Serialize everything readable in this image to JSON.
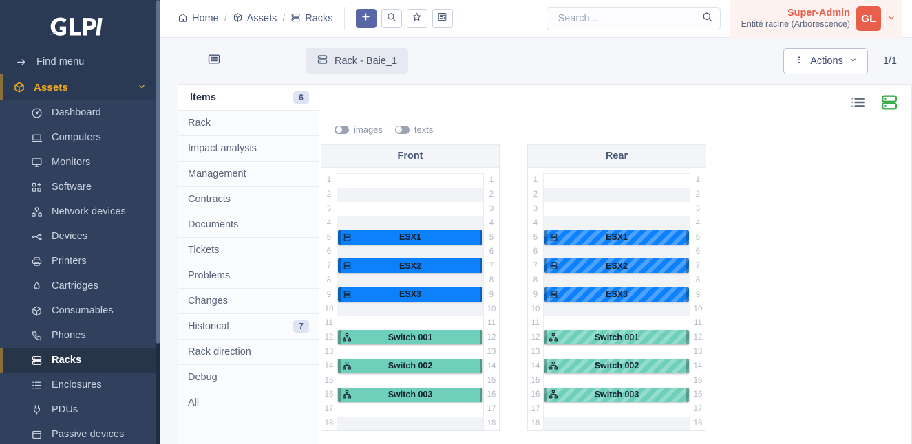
{
  "brand": {
    "name": "GLPI"
  },
  "colors": {
    "sidebar_bg": "#2b3a54",
    "sidebar_sub_bg": "#31415d",
    "accent_orange": "#f0a81e",
    "user_red": "#e8604c",
    "server_blue": "#0d81fb",
    "switch_teal": "#6ed0bb",
    "active_green": "#3cab4b",
    "primary_button": "#5866a5"
  },
  "sidebar": {
    "find_menu": {
      "label": "Find menu",
      "icon": "arrow-right-icon"
    },
    "section": {
      "label": "Assets",
      "icon": "box-icon",
      "caret": "chevron-down-icon"
    },
    "items": [
      {
        "label": "Dashboard",
        "icon": "dashboard-icon",
        "active": false
      },
      {
        "label": "Computers",
        "icon": "computer-icon",
        "active": false
      },
      {
        "label": "Monitors",
        "icon": "monitor-icon",
        "active": false
      },
      {
        "label": "Software",
        "icon": "software-icon",
        "active": false
      },
      {
        "label": "Network devices",
        "icon": "network-device-icon",
        "active": false
      },
      {
        "label": "Devices",
        "icon": "usb-icon",
        "active": false
      },
      {
        "label": "Printers",
        "icon": "printer-icon",
        "active": false
      },
      {
        "label": "Cartridges",
        "icon": "cartridge-icon",
        "active": false
      },
      {
        "label": "Consumables",
        "icon": "consumable-icon",
        "active": false
      },
      {
        "label": "Phones",
        "icon": "phone-icon",
        "active": false
      },
      {
        "label": "Racks",
        "icon": "rack-icon",
        "active": true
      },
      {
        "label": "Enclosures",
        "icon": "enclosure-icon",
        "active": false
      },
      {
        "label": "PDUs",
        "icon": "pdu-icon",
        "active": false
      },
      {
        "label": "Passive devices",
        "icon": "passive-device-icon",
        "active": false
      }
    ]
  },
  "header": {
    "breadcrumb": [
      {
        "label": "Home",
        "icon": "home-icon"
      },
      {
        "label": "Assets",
        "icon": "box-icon"
      },
      {
        "label": "Racks",
        "icon": "rack-icon"
      }
    ],
    "separator": "/",
    "buttons": [
      {
        "name": "add-button",
        "icon": "plus-icon",
        "label": "+",
        "primary": true
      },
      {
        "name": "search-button",
        "icon": "search-icon",
        "label": "",
        "primary": false
      },
      {
        "name": "favorite-button",
        "icon": "star-icon",
        "label": "",
        "primary": false
      },
      {
        "name": "saved-searches-button",
        "icon": "list-settings-icon",
        "label": "",
        "primary": false
      }
    ],
    "search": {
      "placeholder": "Search...",
      "value": "",
      "icon": "search-icon"
    },
    "user": {
      "name": "Super-Admin",
      "entity": "Entité racine (Arborescence)",
      "initials": "GL",
      "caret": "chevron-down-icon"
    }
  },
  "toolbar": {
    "list_toggle_icon": "list-panel-icon",
    "tab": {
      "label": "Rack - Baie_1",
      "icon": "rack-icon"
    },
    "actions": {
      "label": "Actions",
      "icon": "dots-vertical-icon",
      "caret": "chevron-down-icon"
    },
    "pager": "1/1"
  },
  "menu": {
    "header": {
      "label": "Items",
      "badge": "6"
    },
    "items": [
      {
        "label": "Rack",
        "badge": ""
      },
      {
        "label": "Impact analysis",
        "badge": ""
      },
      {
        "label": "Management",
        "badge": ""
      },
      {
        "label": "Contracts",
        "badge": ""
      },
      {
        "label": "Documents",
        "badge": ""
      },
      {
        "label": "Tickets",
        "badge": ""
      },
      {
        "label": "Problems",
        "badge": ""
      },
      {
        "label": "Changes",
        "badge": ""
      },
      {
        "label": "Historical",
        "badge": "7"
      },
      {
        "label": "Rack direction",
        "badge": ""
      },
      {
        "label": "Debug",
        "badge": ""
      },
      {
        "label": "All",
        "badge": ""
      }
    ]
  },
  "rackview": {
    "view_buttons": [
      {
        "name": "list-view-button",
        "icon": "list-icon",
        "active": false
      },
      {
        "name": "rack-view-button",
        "icon": "rack-icon",
        "active": true
      }
    ],
    "toggles": [
      {
        "label": "images",
        "on": false
      },
      {
        "label": "texts",
        "on": false
      }
    ],
    "units": [
      1,
      2,
      3,
      4,
      5,
      6,
      7,
      8,
      9,
      10,
      11,
      12,
      13,
      14,
      15,
      16,
      17,
      18
    ],
    "panels": [
      {
        "title": "Front",
        "hatched": false,
        "devices": [
          {
            "name": "ESX1",
            "unit": 5,
            "height": 1,
            "color": "#0d81fb",
            "icon": "server-icon"
          },
          {
            "name": "ESX2",
            "unit": 7,
            "height": 1,
            "color": "#0d81fb",
            "icon": "server-icon"
          },
          {
            "name": "ESX3",
            "unit": 9,
            "height": 1,
            "color": "#0d81fb",
            "icon": "server-icon"
          },
          {
            "name": "Switch 001",
            "unit": 12,
            "height": 1,
            "color": "#6ed0bb",
            "icon": "network-device-icon"
          },
          {
            "name": "Switch 002",
            "unit": 14,
            "height": 1,
            "color": "#6ed0bb",
            "icon": "network-device-icon"
          },
          {
            "name": "Switch 003",
            "unit": 16,
            "height": 1,
            "color": "#6ed0bb",
            "icon": "network-device-icon"
          }
        ]
      },
      {
        "title": "Rear",
        "hatched": true,
        "devices": [
          {
            "name": "ESX1",
            "unit": 5,
            "height": 1,
            "color": "#0d81fb",
            "icon": "server-icon"
          },
          {
            "name": "ESX2",
            "unit": 7,
            "height": 1,
            "color": "#0d81fb",
            "icon": "server-icon"
          },
          {
            "name": "ESX3",
            "unit": 9,
            "height": 1,
            "color": "#0d81fb",
            "icon": "server-icon"
          },
          {
            "name": "Switch 001",
            "unit": 12,
            "height": 1,
            "color": "#6ed0bb",
            "icon": "network-device-icon"
          },
          {
            "name": "Switch 002",
            "unit": 14,
            "height": 1,
            "color": "#6ed0bb",
            "icon": "network-device-icon"
          },
          {
            "name": "Switch 003",
            "unit": 16,
            "height": 1,
            "color": "#6ed0bb",
            "icon": "network-device-icon"
          }
        ]
      }
    ]
  }
}
